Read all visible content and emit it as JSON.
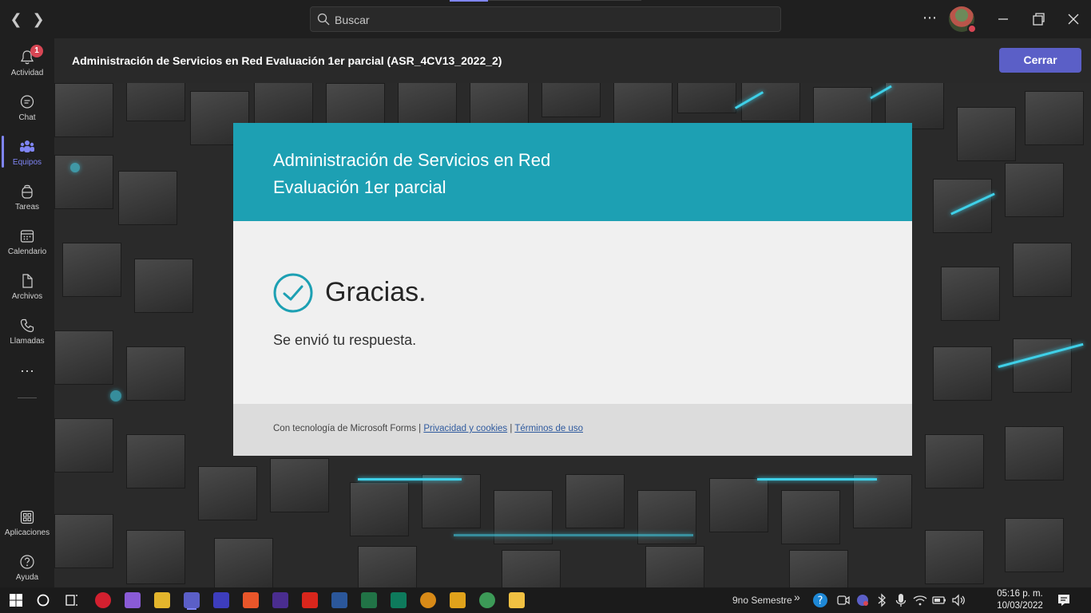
{
  "titlebar": {
    "search_placeholder": "Buscar"
  },
  "sidebar": {
    "items": [
      {
        "label": "Actividad",
        "badge": "1"
      },
      {
        "label": "Chat"
      },
      {
        "label": "Equipos"
      },
      {
        "label": "Tareas"
      },
      {
        "label": "Calendario"
      },
      {
        "label": "Archivos"
      },
      {
        "label": "Llamadas"
      },
      {
        "label": "Aplicaciones"
      },
      {
        "label": "Ayuda"
      }
    ],
    "more": "···"
  },
  "header": {
    "title": "Administración de Servicios en Red Evaluación 1er parcial (ASR_4CV13_2022_2)",
    "close_label": "Cerrar"
  },
  "form": {
    "title_line1": "Administración de Servicios en Red",
    "title_line2": "Evaluación 1er parcial",
    "thanks": "Gracias.",
    "submitted": "Se envió tu respuesta.",
    "footer_prefix": "Con tecnología de Microsoft Forms | ",
    "privacy_link": "Privacidad y cookies",
    "footer_sep": " | ",
    "terms_link": "Términos de uso",
    "header_color": "#1da0b3"
  },
  "taskbar": {
    "folder_label": "9no Semestre",
    "time": "05:16 p. m.",
    "date": "10/03/2022"
  },
  "colors": {
    "accent": "#5b5fc7",
    "teams_purple": "#7f85f5",
    "badge_red": "#d74654"
  }
}
